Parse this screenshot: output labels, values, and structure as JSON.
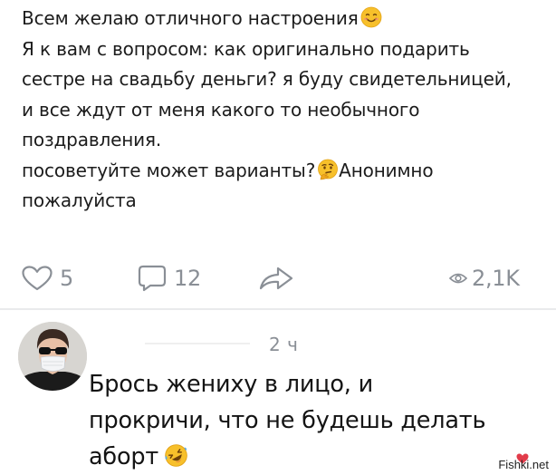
{
  "post": {
    "lines": [
      "Всем желаю отличного настроения",
      "Я к вам с вопросом: как оригинально подарить",
      "сестре на свадьбу деньги? я буду свидетельницей,",
      "и все ждут от меня какого то необычного",
      "поздравления.",
      "посоветуйте может варианты?",
      "Анонимно",
      "пожалуйста"
    ]
  },
  "actions": {
    "likes": "5",
    "comments": "12",
    "views": "2,1K"
  },
  "comment": {
    "time": "2 ч",
    "lines": [
      "Брось жениху в лицо, и",
      "прокричи, что не будешь делать",
      "аборт"
    ]
  },
  "icons": {
    "like": "heart-outline-icon",
    "comment": "comment-bubble-icon",
    "share": "share-arrow-icon",
    "views": "eye-icon",
    "emoji_smile": "smiling-face-icon",
    "emoji_thinking": "thinking-face-icon",
    "emoji_rofl": "rolling-laughing-face-icon"
  },
  "watermark": {
    "text": "Fishki.net"
  },
  "colors": {
    "text": "#1c1c1c",
    "muted": "#8a8f96",
    "emoji": "#f7c02b"
  }
}
